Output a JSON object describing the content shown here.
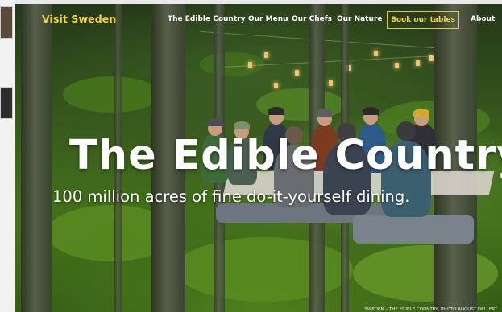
{
  "header": {
    "logo_text": "Visit Sweden",
    "nav_items": [
      {
        "label": "The Edible Country"
      },
      {
        "label": "Our Menu"
      },
      {
        "label": "Our Chefs"
      },
      {
        "label": "Our Nature"
      }
    ],
    "cta_label": "Book our tables",
    "about_label": "About"
  },
  "hero": {
    "title": "The Edible Country",
    "subtitle": "100 million acres of fine do-it-yourself dining.",
    "photo_credit": "SWEDEN – THE EDIBLE COUNTRY, PHOTO AUGUST DELLERT"
  },
  "colors": {
    "brand_yellow": "#f4d43c",
    "cta_border": "#e5c740",
    "nav_text": "#ffffff"
  },
  "icons": {
    "hero_image": "forest-dining-photo"
  }
}
